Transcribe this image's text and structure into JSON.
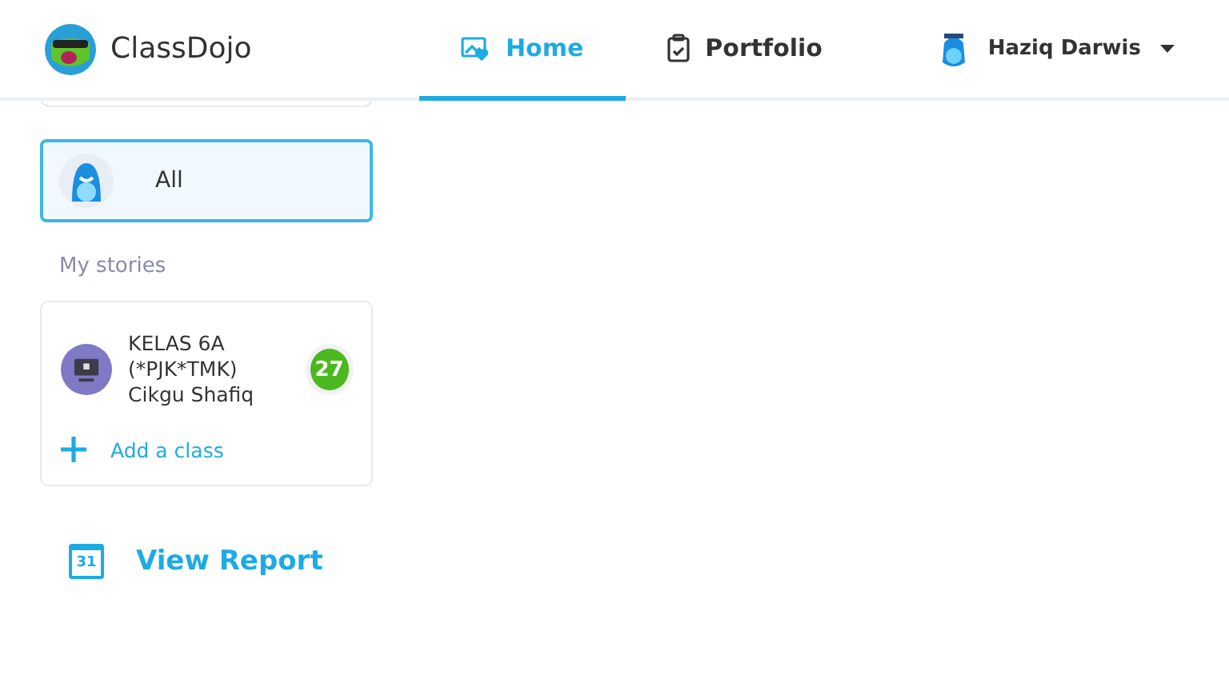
{
  "brand": {
    "name": "ClassDojo"
  },
  "tabs": [
    {
      "label": "Home",
      "kind": "gallery",
      "selected": true
    },
    {
      "label": "Portfolio",
      "kind": "portfolio",
      "selected": false
    }
  ],
  "user": {
    "name": "Haziq Darwis"
  },
  "filter": {
    "label": "All",
    "selected": true
  },
  "stories_heading": "My stories",
  "classes": [
    {
      "name": "KELAS 6A (*PJK*TMK) Cikgu Shafiq",
      "count": "27"
    }
  ],
  "add_class": "Add a class",
  "report": {
    "label": "View Report",
    "calendar_day": "31"
  }
}
